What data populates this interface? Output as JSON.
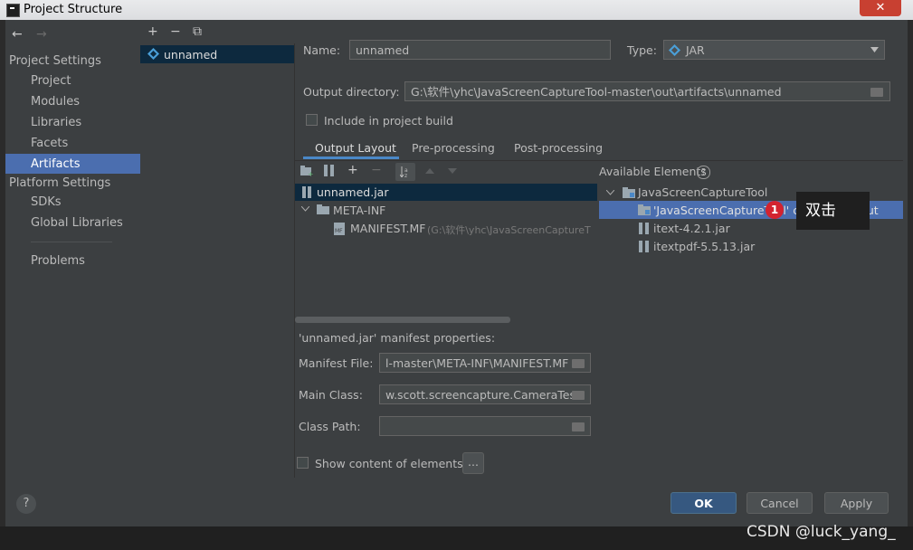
{
  "window": {
    "title": "Project Structure",
    "close_glyph": "✕"
  },
  "nav": {
    "back_glyph": "←",
    "forward_glyph": "→",
    "project_settings": "Project Settings",
    "items_project": [
      "Project",
      "Modules",
      "Libraries",
      "Facets",
      "Artifacts"
    ],
    "platform_settings": "Platform Settings",
    "items_platform": [
      "SDKs",
      "Global Libraries"
    ],
    "problems": "Problems",
    "selected": "Artifacts"
  },
  "artifacts_toolbar": {
    "add": "+",
    "remove": "−",
    "copy": "⧉"
  },
  "artifact_list": [
    "unnamed"
  ],
  "form": {
    "name_label": "Name:",
    "name_value": "unnamed",
    "type_label": "Type:",
    "type_value": "JAR",
    "output_dir_label": "Output directory:",
    "output_dir_value": "G:\\软件\\yhc\\JavaScreenCaptureTool-master\\out\\artifacts\\unnamed",
    "include_label": "Include in project build"
  },
  "tabs": [
    "Output Layout",
    "Pre-processing",
    "Post-processing"
  ],
  "output_tree": {
    "jar": "unnamed.jar",
    "meta_inf": "META-INF",
    "manifest": "MANIFEST.MF",
    "manifest_path": "(G:\\软件\\yhc\\JavaScreenCaptureT"
  },
  "available": {
    "header": "Available Elements",
    "help": "?",
    "project": "JavaScreenCaptureTool",
    "items": [
      "'JavaScreenCaptureTool' compile output",
      "itext-4.2.1.jar",
      "itextpdf-5.5.13.jar"
    ]
  },
  "manifest_props": {
    "title": "'unnamed.jar' manifest properties:",
    "manifest_file_label": "Manifest File:",
    "manifest_file_value": "l-master\\META-INF\\MANIFEST.MF",
    "main_class_label": "Main Class:",
    "main_class_value": "w.scott.screencapture.CameraTest",
    "class_path_label": "Class Path:",
    "class_path_value": "",
    "show_content_label": "Show content of elements",
    "ellipsis": "..."
  },
  "buttons": {
    "ok": "OK",
    "cancel": "Cancel",
    "apply": "Apply",
    "help": "?"
  },
  "annotation": {
    "badge": "1",
    "text": "双击"
  },
  "watermark": "CSDN @luck_yang_"
}
